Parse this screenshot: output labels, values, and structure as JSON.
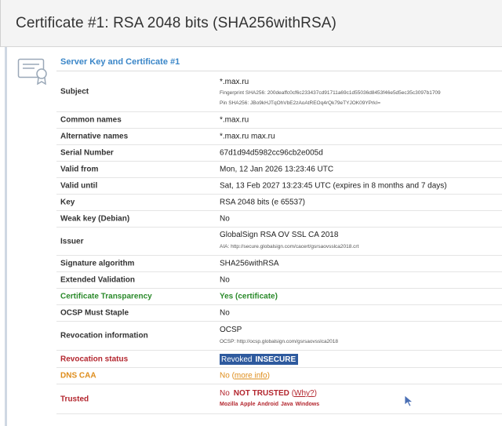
{
  "page": {
    "title": "Certificate #1: RSA 2048 bits (SHA256withRSA)",
    "section_title": "Server Key and Certificate #1"
  },
  "rows": {
    "subject": {
      "label": "Subject",
      "value": "*.max.ru",
      "fingerprint": "Fingerprint SHA256: 200deaffc0cf6c233437cd91711a69c1d55036d8453f46e5d5ec35c3097b1709",
      "pin": "Pin SHA256: JBo9kHJTqOhVbE2zAoAtREOq4rQk79eTYJOK09YPrkI="
    },
    "common_names": {
      "label": "Common names",
      "value": "*.max.ru"
    },
    "alternative_names": {
      "label": "Alternative names",
      "value": "*.max.ru max.ru"
    },
    "serial_number": {
      "label": "Serial Number",
      "value": "67d1d94d5982cc96cb2e005d"
    },
    "valid_from": {
      "label": "Valid from",
      "value": "Mon, 12 Jan 2026 13:23:46 UTC"
    },
    "valid_until": {
      "label": "Valid until",
      "value": "Sat, 13 Feb 2027 13:23:45 UTC (expires in 8 months and 7 days)"
    },
    "key": {
      "label": "Key",
      "value": "RSA 2048 bits (e 65537)"
    },
    "weak_key": {
      "label": "Weak key (Debian)",
      "value": "No"
    },
    "issuer": {
      "label": "Issuer",
      "value": "GlobalSign RSA OV SSL CA 2018",
      "aia": "AIA: http://secure.globalsign.com/cacert/gsrsaovsslca2018.crt"
    },
    "signature_algorithm": {
      "label": "Signature algorithm",
      "value": "SHA256withRSA"
    },
    "extended_validation": {
      "label": "Extended Validation",
      "value": "No"
    },
    "certificate_transparency": {
      "label": "Certificate Transparency",
      "value": "Yes (certificate)"
    },
    "ocsp_must_staple": {
      "label": "OCSP Must Staple",
      "value": "No"
    },
    "revocation_information": {
      "label": "Revocation information",
      "value": "OCSP",
      "ocsp": "OCSP: http://ocsp.globalsign.com/gsrsaovsslca2018"
    },
    "revocation_status": {
      "label": "Revocation status",
      "value_prefix": "Revoked",
      "value_strong": "INSECURE"
    },
    "dns_caa": {
      "label": "DNS CAA",
      "value_prefix": "No",
      "link_open": "(",
      "link": "more info",
      "link_close": ")"
    },
    "trusted": {
      "label": "Trusted",
      "value_prefix": "No",
      "value_strong": "NOT TRUSTED",
      "link_open": "(",
      "link": "Why?",
      "link_close": ")",
      "stores": [
        "Mozilla",
        "Apple",
        "Android",
        "Java",
        "Windows"
      ]
    }
  },
  "colors": {
    "section_title": "#3a86c8",
    "transparency_green": "#2a8a2a",
    "alert_red": "#b3262e",
    "caa_orange": "#de8c1a",
    "revoked_badge": "#2e5a9e"
  },
  "icons": {
    "certificate": "certificate-icon",
    "cursor": "mouse-cursor-icon"
  }
}
